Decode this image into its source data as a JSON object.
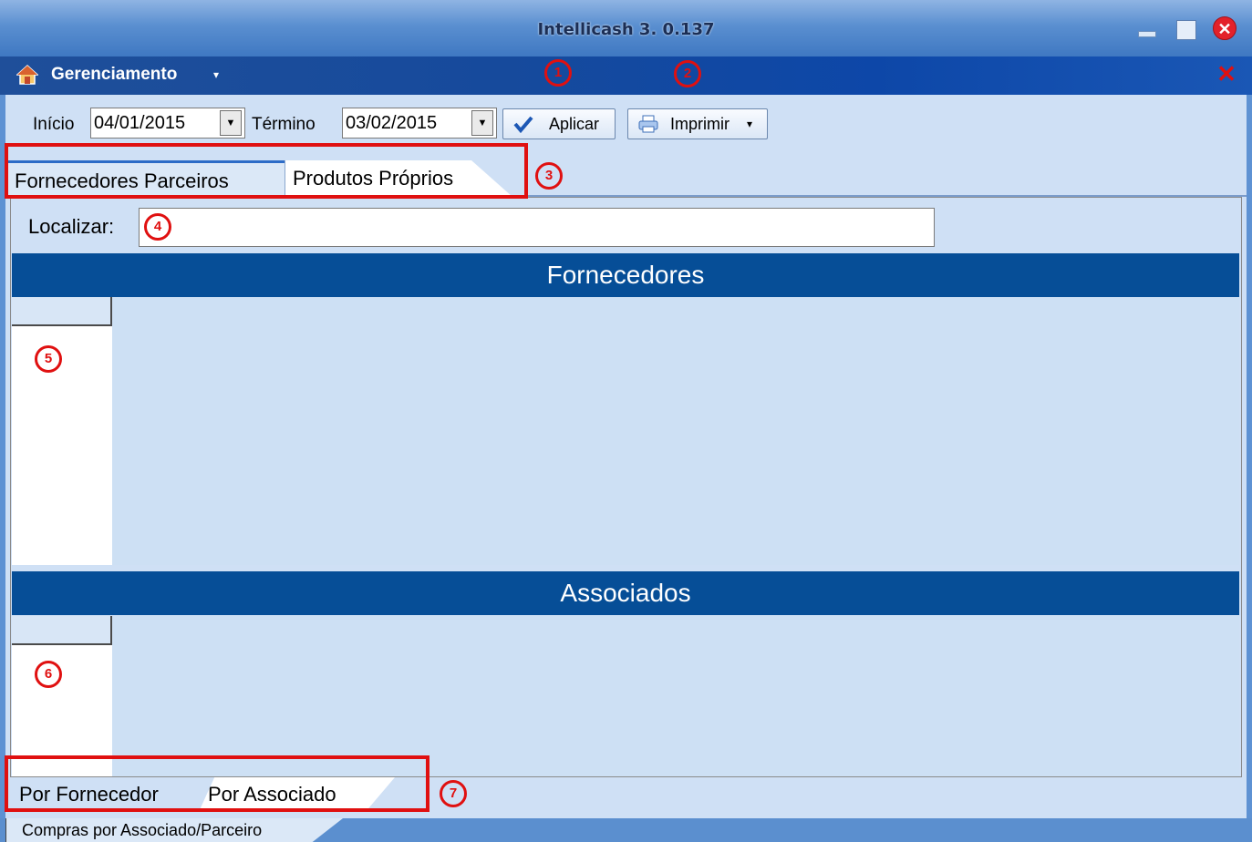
{
  "window": {
    "title": "Intellicash 3. 0.137",
    "controls": {
      "minimize_icon": "minimize-icon",
      "maximize_icon": "maximize-icon",
      "close_icon": "close-icon"
    }
  },
  "menubar": {
    "menu_label": "Gerenciamento",
    "caret": "▾",
    "home_icon": "home-icon",
    "close": "✕"
  },
  "toolbar": {
    "inicio_label": "Início",
    "inicio_value": "04/01/2015",
    "termino_label": "Término",
    "termino_value": "03/02/2015",
    "dropdown_arrow": "▼",
    "aplicar_label": "Aplicar",
    "imprimir_label": "Imprimir",
    "imprimir_caret": "▾"
  },
  "tabs": [
    {
      "label": "Fornecedores Parceiros",
      "active": true
    },
    {
      "label": "Produtos Próprios",
      "active": false
    }
  ],
  "search": {
    "label": "Localizar:",
    "value": ""
  },
  "sections": {
    "fornecedores_title": "Fornecedores",
    "associados_title": "Associados"
  },
  "bottom_tabs": [
    {
      "label": "Por Fornecedor",
      "active": true
    },
    {
      "label": "Por Associado",
      "active": false
    }
  ],
  "statusbar": {
    "text": "Compras por Associado/Parceiro"
  },
  "annotations": [
    "1",
    "2",
    "3",
    "4",
    "5",
    "6",
    "7"
  ],
  "colors": {
    "title_gradient_top": "#8fb4e3",
    "menubar": "#164a9c",
    "section_band": "#064e97",
    "panel_bg": "#cfe0f5",
    "annotation_red": "#e01010"
  }
}
